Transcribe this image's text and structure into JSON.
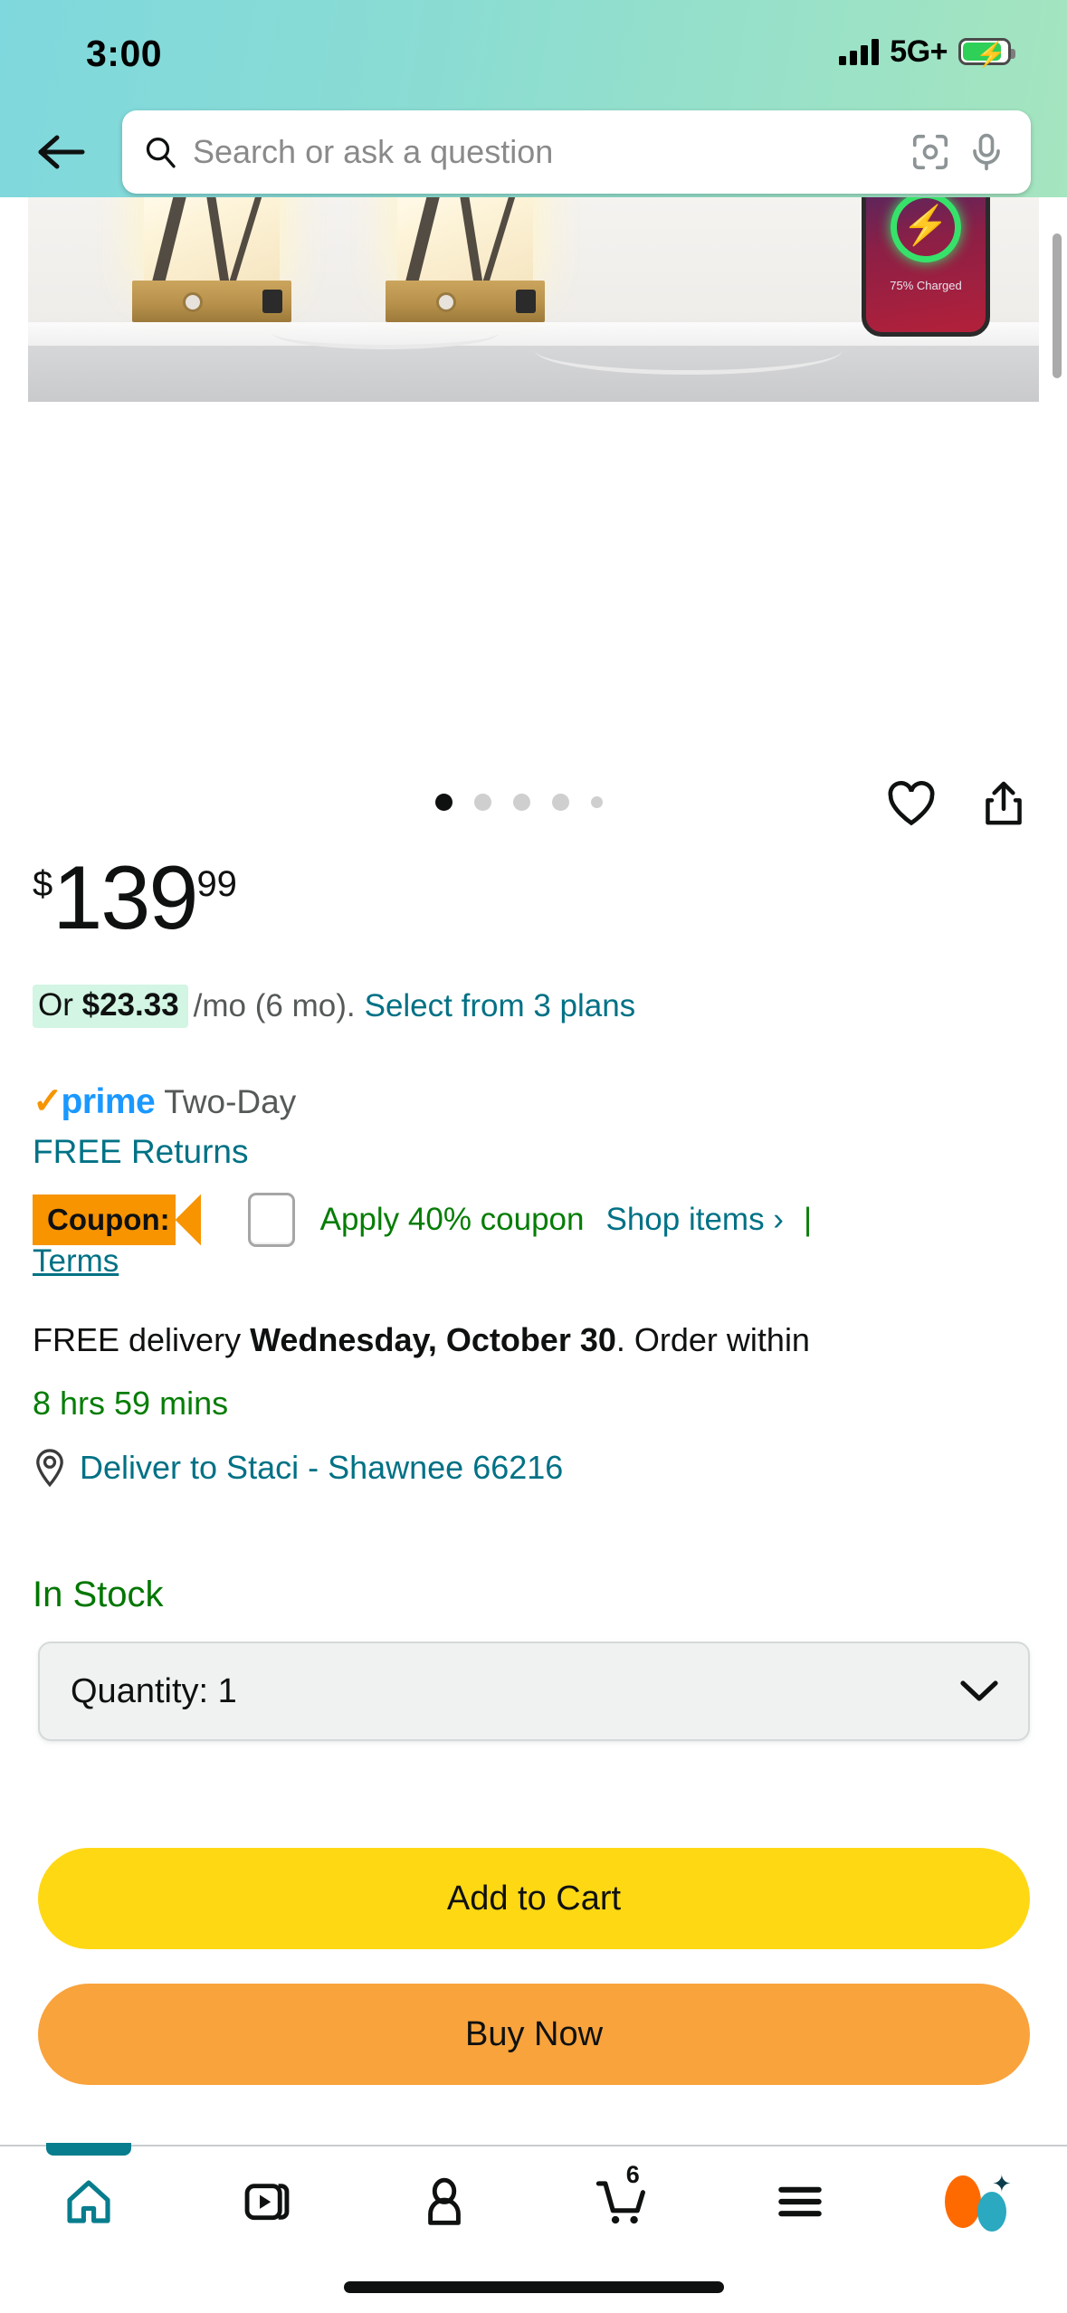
{
  "status_bar": {
    "time": "3:00",
    "network": "5G+",
    "signal_icon": "signal-bars-icon",
    "battery_icon": "battery-charging-icon"
  },
  "header": {
    "back_icon": "back-arrow-icon",
    "search": {
      "placeholder": "Search or ask a question",
      "value": "",
      "search_icon": "search-icon",
      "camera_icon": "camera-lens-icon",
      "mic_icon": "microphone-icon"
    }
  },
  "gallery": {
    "phone_status_text": "75% Charged",
    "dots_total": 5,
    "dots_active_index": 0,
    "wishlist_icon": "heart-icon",
    "share_icon": "share-icon"
  },
  "price": {
    "currency": "$",
    "whole": "139",
    "fraction": "99"
  },
  "installment": {
    "prefix": "Or ",
    "amount": "$23.33",
    "period": "/mo (6 mo).",
    "link": "Select from 3 plans",
    "highlight_color": "#d3f5e3"
  },
  "prime": {
    "check": "✓",
    "word": "prime",
    "shipping_speed": "Two-Day",
    "free_returns": "FREE Returns",
    "prime_color": "#1a98ff",
    "check_color": "#f79400"
  },
  "coupon": {
    "badge_label": "Coupon:",
    "checkbox_checked": false,
    "apply_label": "Apply 40% coupon",
    "shop_items_label": "Shop items ›",
    "divider": "|",
    "terms_label": "Terms",
    "badge_color": "#f79400",
    "apply_color": "#067d06"
  },
  "delivery": {
    "line_prefix": "FREE delivery ",
    "date": "Wednesday, October 30",
    "line_suffix": ". Order within",
    "countdown": "8 hrs 59 mins",
    "location_icon": "location-pin-icon",
    "deliver_to": "Deliver to Staci - Shawnee 66216"
  },
  "availability": {
    "status": "In Stock",
    "status_color": "#007600"
  },
  "quantity": {
    "label": "Quantity:",
    "value": "1",
    "display": "Quantity:  1",
    "chevron_icon": "chevron-down-icon"
  },
  "actions": {
    "add_to_cart": "Add to Cart",
    "buy_now": "Buy Now",
    "cart_color": "#ffd814",
    "buy_color": "#f9a33c"
  },
  "bottom_nav": {
    "items": [
      {
        "name": "home",
        "icon": "home-icon",
        "active": true,
        "badge": ""
      },
      {
        "name": "video",
        "icon": "video-play-icon",
        "active": false,
        "badge": ""
      },
      {
        "name": "account",
        "icon": "person-icon",
        "active": false,
        "badge": ""
      },
      {
        "name": "cart",
        "icon": "shopping-cart-icon",
        "active": false,
        "badge": "6"
      },
      {
        "name": "menu",
        "icon": "hamburger-menu-icon",
        "active": false,
        "badge": ""
      },
      {
        "name": "rufus",
        "icon": "rufus-assistant-icon",
        "active": false,
        "badge": ""
      }
    ],
    "active_color": "#077D8D"
  }
}
